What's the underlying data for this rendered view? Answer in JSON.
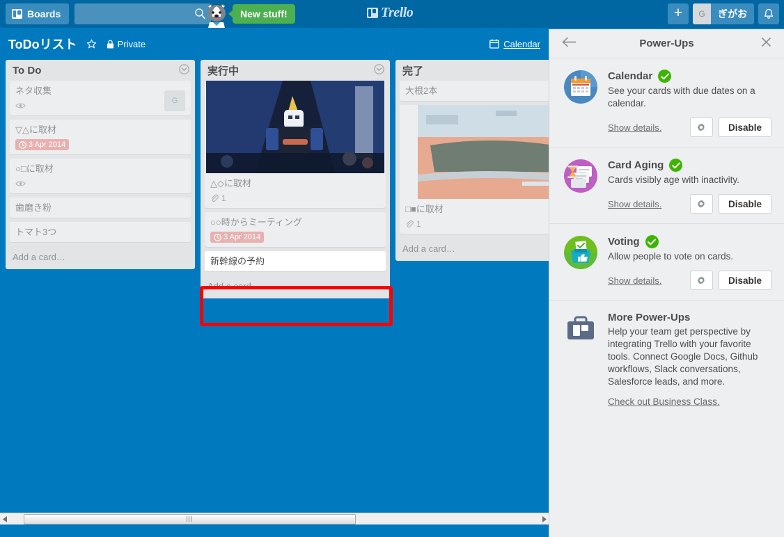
{
  "topbar": {
    "boards_label": "Boards",
    "boards_icon": "board-icon",
    "search_placeholder": "",
    "search_value": "",
    "search_icon": "search-icon",
    "mascot_icon": "husky-mascot-icon",
    "new_stuff_label": "New stuff!",
    "logo_text": "Trello",
    "plus_label": "+",
    "member_initial": "G",
    "member_name": "ぎがお",
    "bell_icon": "bell-icon"
  },
  "boardbar": {
    "title": "ToDoリスト",
    "star_icon": "star-icon",
    "lock_icon": "lock-icon",
    "visibility": "Private",
    "calendar_icon": "calendar-icon",
    "calendar_label": "Calendar"
  },
  "board": {
    "add_card_label": "Add a card…",
    "list_menu_icon": "chevron-down-circle-icon",
    "lists": [
      {
        "title": "To Do",
        "cards": [
          {
            "title": "ネタ収集",
            "label_color": "#eedcbe",
            "badges": [
              {
                "type": "watch",
                "icon": "eye-icon",
                "text": ""
              }
            ],
            "avatar": "G"
          },
          {
            "title": "▽△に取材",
            "label_color": "#b9dba4",
            "badges": [
              {
                "type": "due",
                "icon": "clock-icon",
                "text": "3 Apr 2014"
              }
            ]
          },
          {
            "title": "○□に取材",
            "label_color": "#b9dba4",
            "badges": [
              {
                "type": "watch",
                "icon": "eye-icon",
                "text": ""
              }
            ]
          },
          {
            "title": "歯磨き粉",
            "label_color": "#eae48f",
            "badges": []
          },
          {
            "title": "トマト3つ",
            "label_color": "#eae48f",
            "badges": []
          }
        ]
      },
      {
        "title": "実行中",
        "cards": [
          {
            "title": "△◇に取材",
            "label_color": "#b9dba4",
            "cover": "gundam-photo",
            "badges": [
              {
                "type": "attachment",
                "icon": "paperclip-icon",
                "text": "1"
              }
            ]
          },
          {
            "title": "○○時からミーティング",
            "label_color": "#d5bbdf",
            "badges": [
              {
                "type": "due",
                "icon": "clock-icon",
                "text": "3 Apr 2014"
              }
            ]
          },
          {
            "title": "新幹線の予約",
            "label_color": "#61bd4f",
            "highlighted": true,
            "badges": []
          }
        ]
      },
      {
        "title": "完了",
        "cards": [
          {
            "title": "大根2本",
            "label_color": "#eae48f",
            "badges": []
          },
          {
            "title": "□■に取材",
            "label_color": "#b9dba4",
            "cover": "stadium-photo",
            "badges": [
              {
                "type": "attachment",
                "icon": "paperclip-icon",
                "text": "1"
              }
            ]
          }
        ]
      }
    ]
  },
  "scrollbar": {
    "left_arrow_icon": "arrow-left-icon",
    "right_arrow_icon": "arrow-right-icon",
    "grip_icon": "grip-icon"
  },
  "powerups": {
    "back_icon": "arrow-left-icon",
    "title": "Power-Ups",
    "close_icon": "close-icon",
    "details_label": "Show details.",
    "gear_icon": "gear-icon",
    "disable_label": "Disable",
    "items": [
      {
        "name": "Calendar",
        "icon": "calendar-powerup-icon",
        "enabled_icon": "check-circle-icon",
        "description": "See your cards with due dates on a calendar."
      },
      {
        "name": "Card Aging",
        "icon": "card-aging-powerup-icon",
        "enabled_icon": "check-circle-icon",
        "description": "Cards visibly age with inactivity."
      },
      {
        "name": "Voting",
        "icon": "voting-powerup-icon",
        "enabled_icon": "check-circle-icon",
        "description": "Allow people to vote on cards."
      }
    ],
    "more": {
      "icon": "briefcase-icon",
      "title": "More Power-Ups",
      "description": "Help your team get perspective by integrating Trello with your favorite tools. Connect Google Docs, Github workflows, Slack conversations, Salesforce leads, and more.",
      "link_label": "Check out Business Class."
    }
  },
  "colors": {
    "brand_blue": "#0079bf",
    "header_blue": "#0067a3",
    "green": "#4caf50",
    "highlight_red": "#ff0000"
  }
}
